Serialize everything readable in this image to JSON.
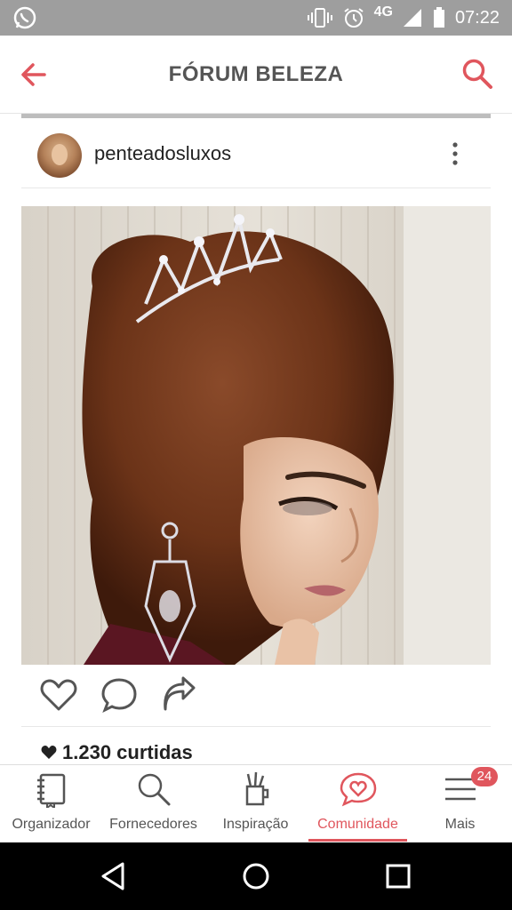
{
  "status_bar": {
    "network": "4G",
    "time": "07:22"
  },
  "app_bar": {
    "title": "FÓRUM BELEZA"
  },
  "post": {
    "username": "penteadosluxos",
    "likes_text": "1.230 curtidas"
  },
  "tab_bar": {
    "tabs": [
      {
        "label": "Organizador",
        "icon": "notebook-icon"
      },
      {
        "label": "Fornecedores",
        "icon": "search-icon"
      },
      {
        "label": "Inspiração",
        "icon": "cup-brushes-icon"
      },
      {
        "label": "Comunidade",
        "icon": "chat-heart-icon",
        "active": true
      },
      {
        "label": "Mais",
        "icon": "menu-icon",
        "badge": "24"
      }
    ]
  },
  "colors": {
    "accent": "#e0565d",
    "status_bar": "#9e9e9e",
    "title_text": "#555555"
  }
}
